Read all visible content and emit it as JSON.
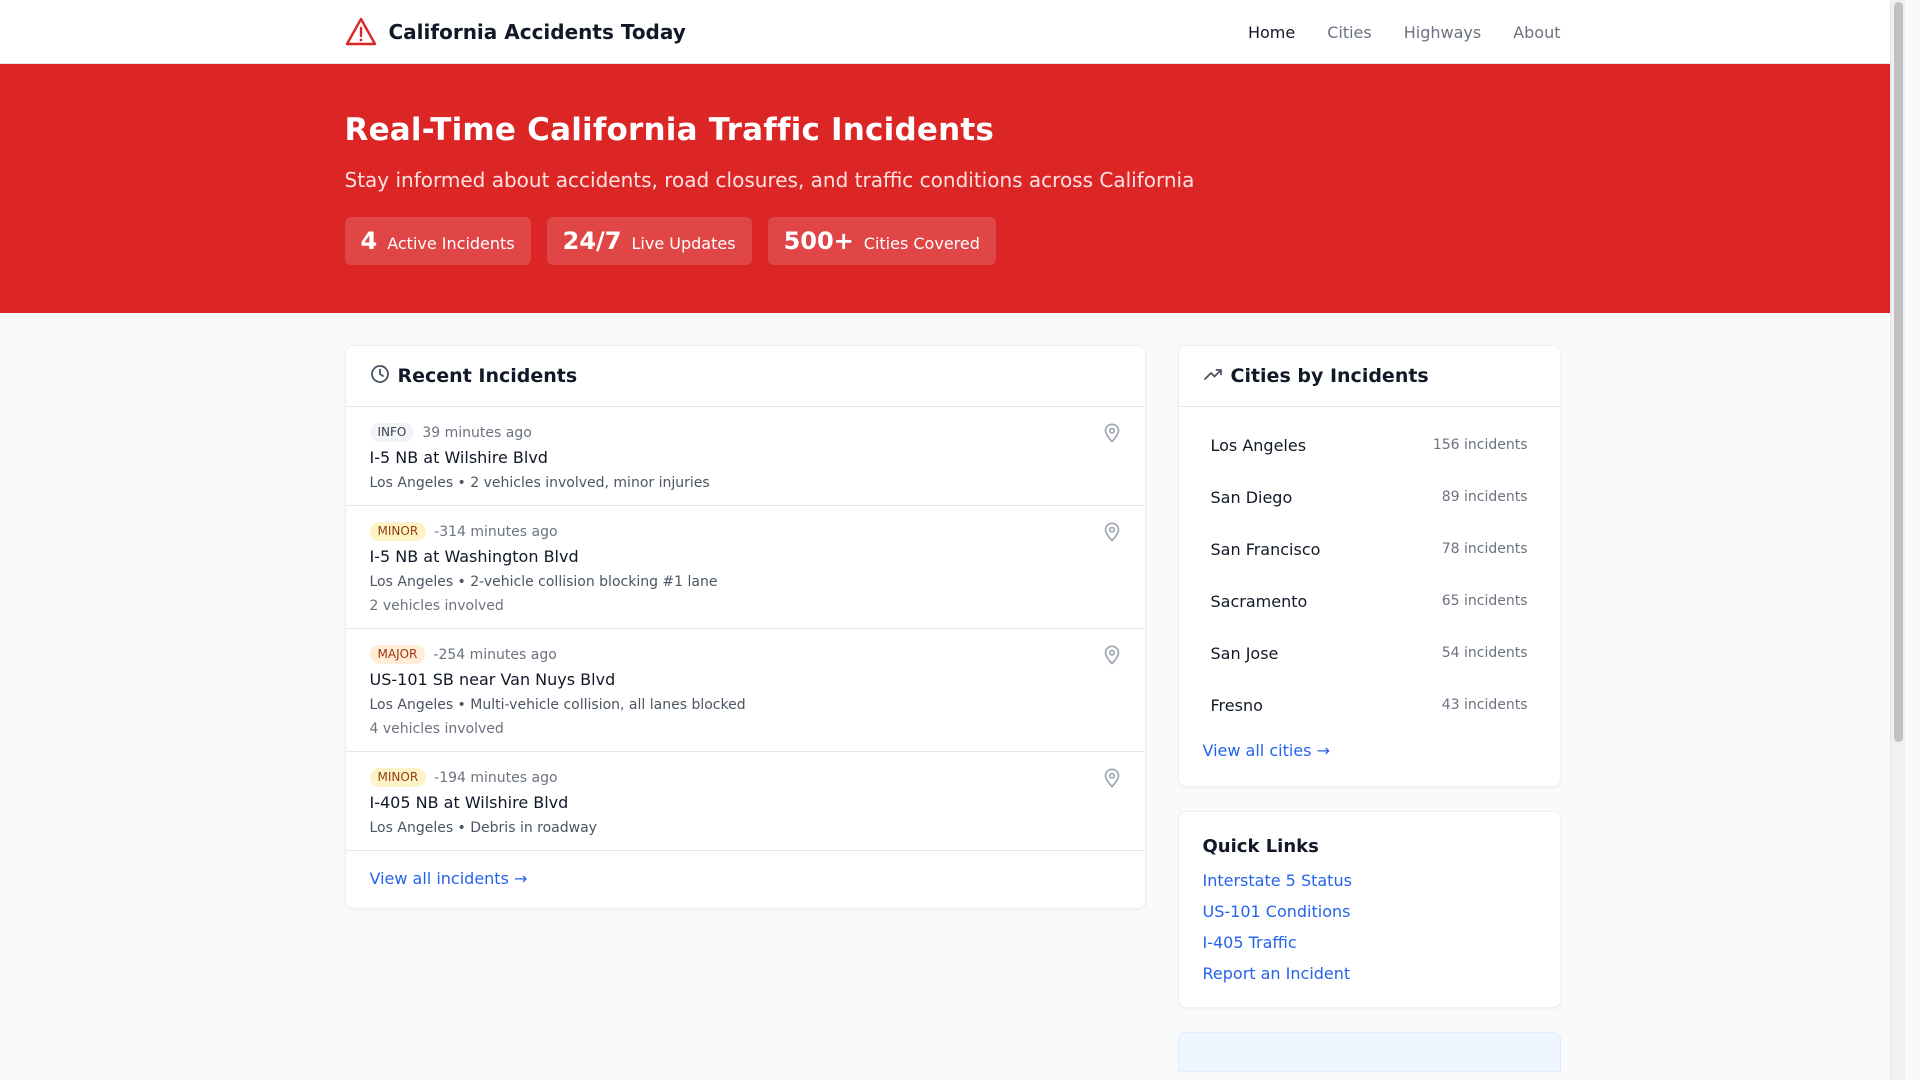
{
  "header": {
    "brand_title": "California Accidents Today",
    "brand_icon": "warning-triangle-icon",
    "nav": [
      {
        "label": "Home"
      },
      {
        "label": "Cities"
      },
      {
        "label": "Highways"
      },
      {
        "label": "About"
      }
    ]
  },
  "hero": {
    "title": "Real-Time California Traffic Incidents",
    "subtitle": "Stay informed about accidents, road closures, and traffic conditions across California",
    "stats": [
      {
        "value": "4",
        "label": "Active Incidents"
      },
      {
        "value": "24/7",
        "label": "Live Updates"
      },
      {
        "value": "500+",
        "label": "Cities Covered"
      }
    ]
  },
  "incidents": {
    "title": "Recent Incidents",
    "title_icon": "clock-icon",
    "items": [
      {
        "severity": "INFO",
        "time": "39 minutes ago",
        "title": "I-5 NB at Wilshire Blvd",
        "desc": "Los Angeles • 2 vehicles involved, minor injuries",
        "vehicles": ""
      },
      {
        "severity": "MINOR",
        "time": "-314 minutes ago",
        "title": "I-5 NB at Washington Blvd",
        "desc": "Los Angeles • 2-vehicle collision blocking #1 lane",
        "vehicles": "2 vehicles involved"
      },
      {
        "severity": "MAJOR",
        "time": "-254 minutes ago",
        "title": "US-101 SB near Van Nuys Blvd",
        "desc": "Los Angeles • Multi-vehicle collision, all lanes blocked",
        "vehicles": "4 vehicles involved"
      },
      {
        "severity": "MINOR",
        "time": "-194 minutes ago",
        "title": "I-405 NB at Wilshire Blvd",
        "desc": "Los Angeles • Debris in roadway",
        "vehicles": ""
      }
    ],
    "view_all": "View all incidents →"
  },
  "cities": {
    "title": "Cities by Incidents",
    "title_icon": "trending-up-icon",
    "items": [
      {
        "name": "Los Angeles",
        "count": "156 incidents"
      },
      {
        "name": "San Diego",
        "count": "89 incidents"
      },
      {
        "name": "San Francisco",
        "count": "78 incidents"
      },
      {
        "name": "Sacramento",
        "count": "65 incidents"
      },
      {
        "name": "San Jose",
        "count": "54 incidents"
      },
      {
        "name": "Fresno",
        "count": "43 incidents"
      }
    ],
    "view_all": "View all cities →"
  },
  "quick_links": {
    "title": "Quick Links",
    "items": [
      {
        "label": "Interstate 5 Status"
      },
      {
        "label": "US-101 Conditions"
      },
      {
        "label": "I-405 Traffic"
      },
      {
        "label": "Report an Incident"
      }
    ]
  },
  "colors": {
    "hero_bg": "#dc2626",
    "link": "#2563eb",
    "brand_icon": "#dc2626"
  }
}
